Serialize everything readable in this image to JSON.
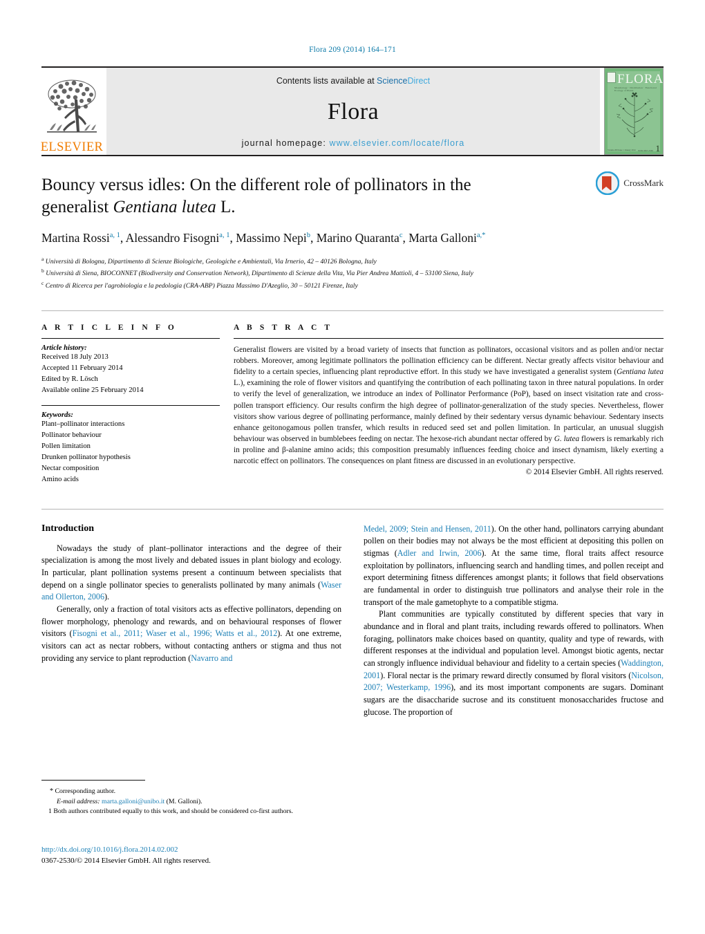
{
  "running_head": "Flora 209 (2014) 164–171",
  "masthead": {
    "publisher_logo_name": "ELSEVIER",
    "contents_prefix": "Contents lists available at ",
    "contents_link": "ScienceDirect",
    "journal_name": "Flora",
    "homepage_prefix": "journal homepage: ",
    "homepage_url": "www.elsevier.com/locate/flora",
    "cover_title": "FLORA",
    "cover_subtitle": "Morphology · Distribution · Functional Ecology of Plants",
    "cover_left_foot": "Volume 209\nIssue 1\nJanuary 2014",
    "cover_right_foot": "ISSN 0367-2530",
    "cover_issue_number": "1"
  },
  "article": {
    "crossmark_label": "CrossMark",
    "title_part1": "Bouncy versus idles: On the different role of pollinators in the generalist ",
    "title_italic": "Gentiana lutea",
    "title_part2": " L.",
    "authors": [
      {
        "name": "Martina Rossi",
        "sup": "a, 1",
        "sep": ","
      },
      {
        "name": "Alessandro Fisogni",
        "sup": "a, 1",
        "sep": ","
      },
      {
        "name": "Massimo Nepi",
        "sup": "b",
        "sep": ","
      },
      {
        "name": "Marino Quaranta",
        "sup": "c",
        "sep": ","
      },
      {
        "name": "Marta Galloni",
        "sup": "a,*",
        "sep": ""
      }
    ],
    "affiliations": [
      {
        "mark": "a",
        "text": "Università di Bologna, Dipartimento di Scienze Biologiche, Geologiche e Ambientali, Via Irnerio, 42 – 40126 Bologna, Italy"
      },
      {
        "mark": "b",
        "text": "Università di Siena, BIOCONNET (Biodiversity and Conservation Network), Dipartimento di Scienze della Vita, Via Pier Andrea Mattioli, 4 – 53100 Siena, Italy"
      },
      {
        "mark": "c",
        "text": "Centro di Ricerca per l'agrobiologia e la pedologia (CRA-ABP) Piazza Massimo D'Azeglio, 30 – 50121 Firenze, Italy"
      }
    ]
  },
  "article_info": {
    "heading": "A R T I C L E    I N F O",
    "history_label": "Article history:",
    "history": [
      "Received 18 July 2013",
      "Accepted 11 February 2014",
      "Edited by R. Lösch",
      "Available online 25 February 2014"
    ],
    "keywords_label": "Keywords:",
    "keywords": [
      "Plant–pollinator interactions",
      "Pollinator behaviour",
      "Pollen limitation",
      "Drunken pollinator hypothesis",
      "Nectar composition",
      "Amino acids"
    ]
  },
  "abstract": {
    "heading": "A B S T R A C T",
    "p1": "Generalist flowers are visited by a broad variety of insects that function as pollinators, occasional visitors and as pollen and/or nectar robbers. Moreover, among legitimate pollinators the pollination efficiency can be different. Nectar greatly affects visitor behaviour and fidelity to a certain species, influencing plant reproductive effort. In this study we have investigated a generalist system (",
    "sp1": "Gentiana lutea",
    "p2": " L.), examining the role of flower visitors and quantifying the contribution of each pollinating taxon in three natural populations. In order to verify the level of generalization, we introduce an index of Pollinator Performance (PoP), based on insect visitation rate and cross-pollen transport efficiency. Our results confirm the high degree of pollinator-generalization of the study species. Nevertheless, flower visitors show various degree of pollinating performance, mainly defined by their sedentary versus dynamic behaviour. Sedentary insects enhance geitonogamous pollen transfer, which results in reduced seed set and pollen limitation. In particular, an unusual sluggish behaviour was observed in bumblebees feeding on nectar. The hexose-rich abundant nectar offered by ",
    "sp2": "G. lutea",
    "p3": " flowers is remarkably rich in proline and β-alanine amino acids; this composition presumably influences feeding choice and insect dynamism, likely exerting a narcotic effect on pollinators. The consequences on plant fitness are discussed in an evolutionary perspective.",
    "copyright": "© 2014 Elsevier GmbH. All rights reserved."
  },
  "introduction": {
    "heading": "Introduction",
    "left": {
      "p1_a": "Nowadays the study of plant–pollinator interactions and the degree of their specialization is among the most lively and debated issues in plant biology and ecology. In particular, plant pollination systems present a continuum between specialists that depend on a single pollinator species to generalists pollinated by many animals (",
      "p1_ref": "Waser and Ollerton, 2006",
      "p1_b": ").",
      "p2_a": "Generally, only a fraction of total visitors acts as effective pollinators, depending on flower morphology, phenology and rewards, and on behavioural responses of flower visitors (",
      "p2_ref": "Fisogni et al., 2011; Waser et al., 1996; Watts et al., 2012",
      "p2_b": "). At one extreme, visitors can act as nectar robbers, without contacting anthers or stigma and thus not providing any service to plant reproduction (",
      "p2_ref2": "Navarro and"
    },
    "right": {
      "p1_ref": "Medel, 2009; Stein and Hensen, 2011",
      "p1_a": "). On the other hand, pollinators carrying abundant pollen on their bodies may not always be the most efficient at depositing this pollen on stigmas (",
      "p1_ref2": "Adler and Irwin, 2006",
      "p1_b": "). At the same time, floral traits affect resource exploitation by pollinators, influencing search and handling times, and pollen receipt and export determining fitness differences amongst plants; it follows that field observations are fundamental in order to distinguish true pollinators and analyse their role in the transport of the male gametophyte to a compatible stigma.",
      "p2_a": "Plant communities are typically constituted by different species that vary in abundance and in floral and plant traits, including rewards offered to pollinators. When foraging, pollinators make choices based on quantity, quality and type of rewards, with different responses at the individual and population level. Amongst biotic agents, nectar can strongly influence individual behaviour and fidelity to a certain species (",
      "p2_ref": "Waddington, 2001",
      "p2_b": "). Floral nectar is the primary reward directly consumed by floral visitors (",
      "p2_ref2": "Nicolson, 2007; Westerkamp, 1996",
      "p2_c": "), and its most important components are sugars. Dominant sugars are the disaccharide sucrose and its constituent monosaccharides fructose and glucose. The proportion of"
    }
  },
  "footnotes": {
    "corresponding_star": "*",
    "corresponding_label": "Corresponding author.",
    "email_label": "E-mail address:",
    "email": "marta.galloni@unibo.it",
    "email_suffix": "(M. Galloni).",
    "note_mark": "1",
    "note_text": "Both authors contributed equally to this work, and should be considered co-first authors."
  },
  "page_footer": {
    "doi": "http://dx.doi.org/10.1016/j.flora.2014.02.002",
    "issn": "0367-2530/© 2014 Elsevier GmbH. All rights reserved."
  },
  "colors": {
    "link_blue": "#1b7fb5",
    "header_blue": "#0b79a8",
    "elsevier_orange": "#f07c00",
    "cover_green": "#72b77a"
  }
}
